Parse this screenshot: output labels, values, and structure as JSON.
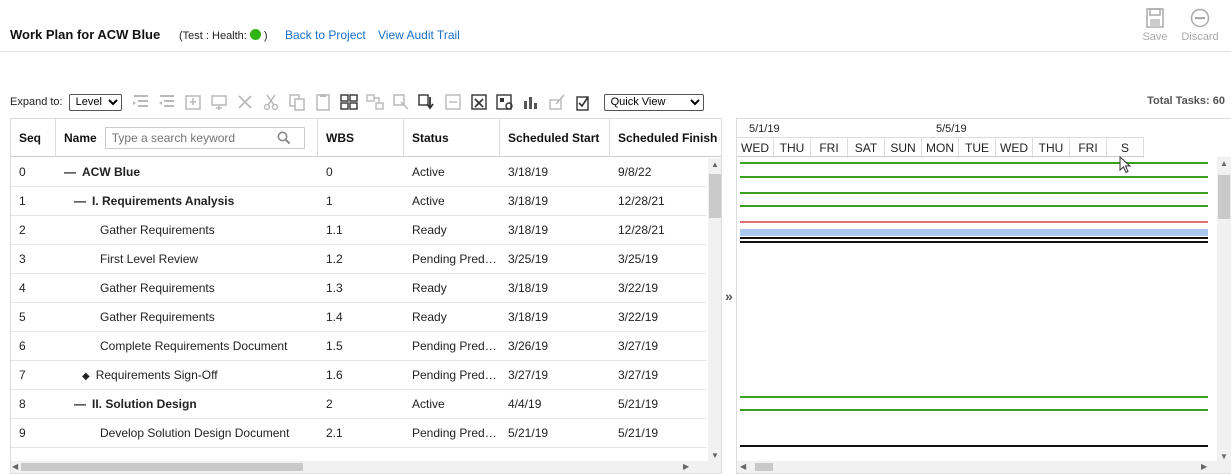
{
  "header": {
    "title": "Work Plan for ACW Blue",
    "health_prefix": "(Test : Health:",
    "health_suffix": ")",
    "health_color": "#2fb511",
    "back_link": "Back to Project",
    "audit_link": "View Audit Trail",
    "save_label": "Save",
    "discard_label": "Discard"
  },
  "toolbar": {
    "expand_label": "Expand to:",
    "expand_value": "Level",
    "quick_view": "Quick View",
    "total_tasks": "Total Tasks: 60",
    "icons": [
      "indent-icon",
      "outdent-icon",
      "insert-task-icon",
      "insert-milestone-icon",
      "delete-icon",
      "cut-icon",
      "copy-icon",
      "paste-icon",
      "hierarchy-icon",
      "link-icon",
      "unlink-icon",
      "export-icon",
      "import-icon",
      "excel-icon",
      "baseline-icon",
      "chart-icon",
      "edit-icon",
      "checklist-icon"
    ]
  },
  "grid": {
    "columns": {
      "seq": "Seq",
      "name": "Name",
      "wbs": "WBS",
      "status": "Status",
      "start": "Scheduled Start",
      "finish": "Scheduled Finish"
    },
    "search_placeholder": "Type a search keyword",
    "rows": [
      {
        "seq": "0",
        "prefix": "—",
        "name": "ACW Blue",
        "wbs": "0",
        "status": "Active",
        "start": "3/18/19",
        "finish": "9/8/22",
        "bold": true,
        "indent": 0
      },
      {
        "seq": "1",
        "prefix": "—",
        "name": "I. Requirements Analysis",
        "wbs": "1",
        "status": "Active",
        "start": "3/18/19",
        "finish": "12/28/21",
        "bold": true,
        "indent": 1
      },
      {
        "seq": "2",
        "prefix": "",
        "name": "Gather Requirements",
        "wbs": "1.1",
        "status": "Ready",
        "start": "3/18/19",
        "finish": "12/28/21",
        "bold": false,
        "indent": 2
      },
      {
        "seq": "3",
        "prefix": "",
        "name": "First Level Review",
        "wbs": "1.2",
        "status": "Pending Pred…",
        "start": "3/25/19",
        "finish": "3/25/19",
        "bold": false,
        "indent": 2
      },
      {
        "seq": "4",
        "prefix": "",
        "name": "Gather Requirements",
        "wbs": "1.3",
        "status": "Ready",
        "start": "3/18/19",
        "finish": "3/22/19",
        "bold": false,
        "indent": 2
      },
      {
        "seq": "5",
        "prefix": "",
        "name": "Gather Requirements",
        "wbs": "1.4",
        "status": "Ready",
        "start": "3/18/19",
        "finish": "3/22/19",
        "bold": false,
        "indent": 2
      },
      {
        "seq": "6",
        "prefix": "",
        "name": "Complete Requirements Document",
        "wbs": "1.5",
        "status": "Pending Pred…",
        "start": "3/26/19",
        "finish": "3/27/19",
        "bold": false,
        "indent": 2
      },
      {
        "seq": "7",
        "prefix": "◆",
        "name": "Requirements Sign-Off",
        "wbs": "1.6",
        "status": "Pending Pred…",
        "start": "3/27/19",
        "finish": "3/27/19",
        "bold": false,
        "indent": 1
      },
      {
        "seq": "8",
        "prefix": "—",
        "name": "II. Solution Design",
        "wbs": "2",
        "status": "Active",
        "start": "4/4/19",
        "finish": "5/21/19",
        "bold": true,
        "indent": 1
      },
      {
        "seq": "9",
        "prefix": "",
        "name": "Develop Solution Design Document",
        "wbs": "2.1",
        "status": "Pending Pred…",
        "start": "5/21/19",
        "finish": "5/21/19",
        "bold": false,
        "indent": 2
      }
    ]
  },
  "gantt": {
    "week_labels": [
      "5/1/19",
      "5/5/19"
    ],
    "days": [
      "WED",
      "THU",
      "FRI",
      "SAT",
      "SUN",
      "MON",
      "TUE",
      "WED",
      "THU",
      "FRI",
      "S"
    ],
    "bar_colors": {
      "green": "#3aa020",
      "red": "#e07070",
      "blue": "#a9c8ef",
      "black": "#111111"
    }
  }
}
